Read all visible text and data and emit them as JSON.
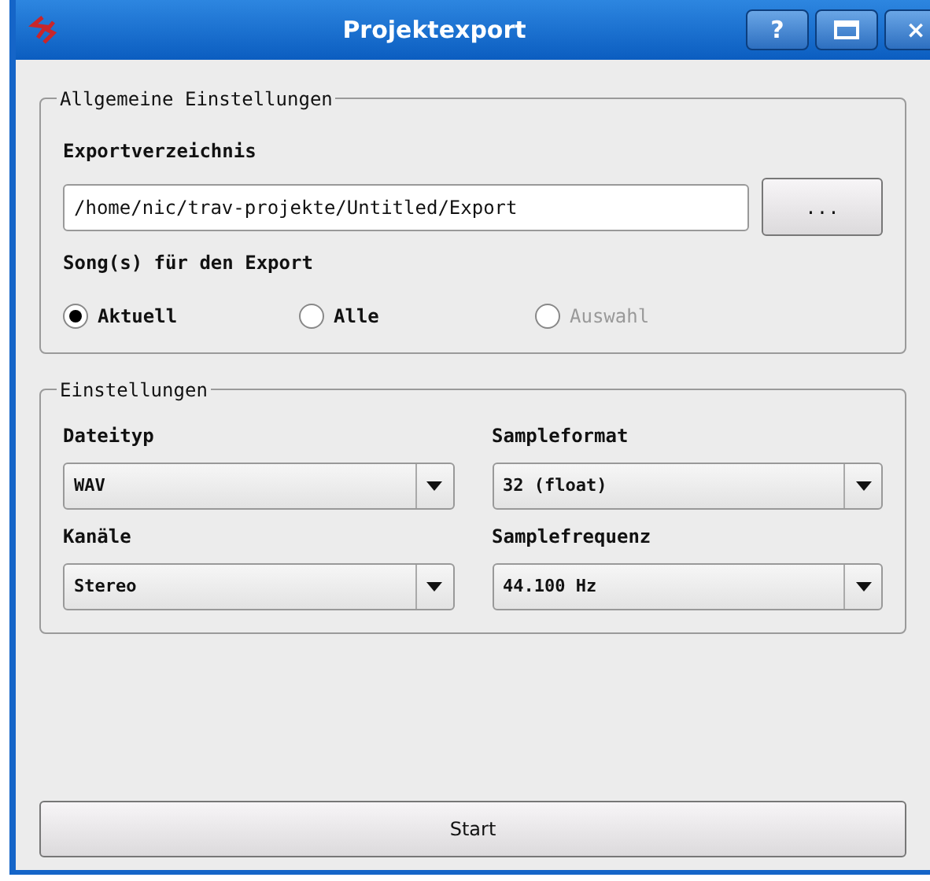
{
  "window": {
    "title": "Projektexport",
    "buttons": [
      "?",
      "×"
    ]
  },
  "general": {
    "title": "Allgemeine Einstellungen",
    "dir_label": "Exportverzeichnis",
    "dir_value": "/home/nic/trav-projekte/Untitled/Export",
    "browse": "...",
    "songs_label": "Song(s) für den Export",
    "options": [
      {
        "label": "Aktuell",
        "selected": true,
        "disabled": false
      },
      {
        "label": "Alle",
        "selected": false,
        "disabled": false
      },
      {
        "label": "Auswahl",
        "selected": false,
        "disabled": true
      }
    ]
  },
  "settings": {
    "title": "Einstellungen",
    "fields": [
      {
        "label": "Dateityp",
        "value": "WAV"
      },
      {
        "label": "Sampleformat",
        "value": "32 (float)"
      },
      {
        "label": "Kanäle",
        "value": "Stereo"
      },
      {
        "label": "Samplefrequenz",
        "value": "44.100 Hz"
      }
    ]
  },
  "start": "Start"
}
